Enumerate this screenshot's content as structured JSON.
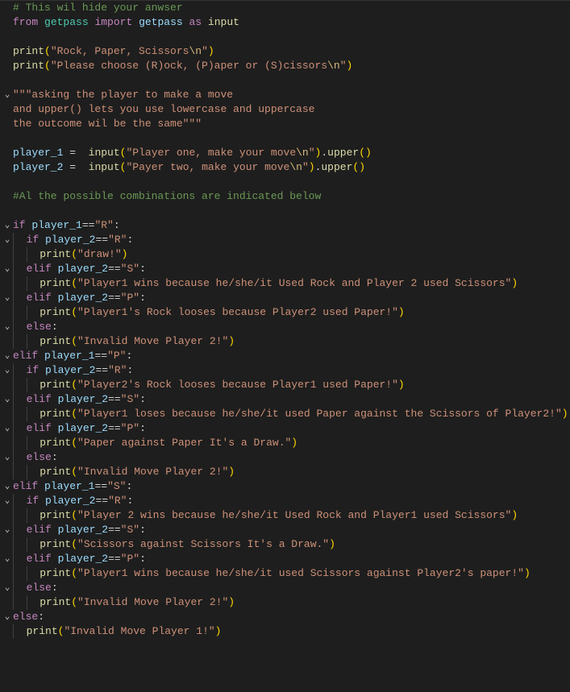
{
  "chevron": "⌄",
  "lines": {
    "l1": {
      "fold": false,
      "tokens": [
        [
          "c-comment",
          "# This wil hide your anwser"
        ]
      ]
    },
    "l2": {
      "fold": false,
      "tokens": [
        [
          "c-key",
          "from"
        ],
        [
          "",
          " "
        ],
        [
          "c-mod",
          "getpass"
        ],
        [
          "",
          " "
        ],
        [
          "c-key",
          "import"
        ],
        [
          "",
          " "
        ],
        [
          "c-var",
          "getpass"
        ],
        [
          "",
          " "
        ],
        [
          "c-key",
          "as"
        ],
        [
          "",
          " "
        ],
        [
          "c-func",
          "input"
        ]
      ]
    },
    "l3": {
      "fold": false,
      "tokens": []
    },
    "l4": {
      "fold": false,
      "tokens": [
        [
          "c-func",
          "print"
        ],
        [
          "c-brace",
          "("
        ],
        [
          "c-str",
          "\"Rock, Paper, Scissors"
        ],
        [
          "c-esc",
          "\\n"
        ],
        [
          "c-str",
          "\""
        ],
        [
          "c-brace",
          ")"
        ]
      ]
    },
    "l5": {
      "fold": false,
      "tokens": [
        [
          "c-func",
          "print"
        ],
        [
          "c-brace",
          "("
        ],
        [
          "c-str",
          "\"Please choose (R)ock, (P)aper or (S)cissors"
        ],
        [
          "c-esc",
          "\\n"
        ],
        [
          "c-str",
          "\""
        ],
        [
          "c-brace",
          ")"
        ]
      ]
    },
    "l6": {
      "fold": false,
      "tokens": []
    },
    "l7": {
      "fold": true,
      "tokens": [
        [
          "c-docstr",
          "\"\"\"asking the player to make a move"
        ]
      ]
    },
    "l8": {
      "fold": false,
      "tokens": [
        [
          "c-docstr",
          "and upper() lets you use lowercase and uppercase"
        ]
      ]
    },
    "l9": {
      "fold": false,
      "tokens": [
        [
          "c-docstr",
          "the outcome wil be the same\"\"\""
        ]
      ]
    },
    "l10": {
      "fold": false,
      "tokens": []
    },
    "l11": {
      "fold": false,
      "tokens": [
        [
          "c-var",
          "player_1"
        ],
        [
          "",
          " "
        ],
        [
          "c-op",
          "="
        ],
        [
          "",
          "  "
        ],
        [
          "c-func",
          "input"
        ],
        [
          "c-brace",
          "("
        ],
        [
          "c-str",
          "\"Player one, make your move"
        ],
        [
          "c-esc",
          "\\n"
        ],
        [
          "c-str",
          "\""
        ],
        [
          "c-brace",
          ")"
        ],
        [
          "c-punc",
          "."
        ],
        [
          "c-func",
          "upper"
        ],
        [
          "c-brace",
          "()"
        ]
      ]
    },
    "l12": {
      "fold": false,
      "tokens": [
        [
          "c-var",
          "player_2"
        ],
        [
          "",
          " "
        ],
        [
          "c-op",
          "="
        ],
        [
          "",
          "  "
        ],
        [
          "c-func",
          "input"
        ],
        [
          "c-brace",
          "("
        ],
        [
          "c-str",
          "\"Payer two, make your move"
        ],
        [
          "c-esc",
          "\\n"
        ],
        [
          "c-str",
          "\""
        ],
        [
          "c-brace",
          ")"
        ],
        [
          "c-punc",
          "."
        ],
        [
          "c-func",
          "upper"
        ],
        [
          "c-brace",
          "()"
        ]
      ]
    },
    "l13": {
      "fold": false,
      "tokens": []
    },
    "l14": {
      "fold": false,
      "tokens": [
        [
          "c-comment",
          "#Al the possible combinations are indicated below"
        ]
      ]
    },
    "l15": {
      "fold": false,
      "tokens": []
    },
    "l16": {
      "fold": true,
      "tokens": [
        [
          "c-key",
          "if"
        ],
        [
          "",
          " "
        ],
        [
          "c-var",
          "player_1"
        ],
        [
          "c-op",
          "=="
        ],
        [
          "c-str",
          "\"R\""
        ],
        [
          "c-punc",
          ":"
        ]
      ]
    },
    "l17": {
      "fold": true,
      "indent": 1,
      "tokens": [
        [
          "c-key",
          "if"
        ],
        [
          "",
          " "
        ],
        [
          "c-var",
          "player_2"
        ],
        [
          "c-op",
          "=="
        ],
        [
          "c-str",
          "\"R\""
        ],
        [
          "c-punc",
          ":"
        ]
      ]
    },
    "l18": {
      "fold": false,
      "indent": 2,
      "tokens": [
        [
          "c-func",
          "print"
        ],
        [
          "c-brace",
          "("
        ],
        [
          "c-str",
          "\"draw!\""
        ],
        [
          "c-brace",
          ")"
        ]
      ]
    },
    "l19": {
      "fold": true,
      "indent": 1,
      "tokens": [
        [
          "c-key",
          "elif"
        ],
        [
          "",
          " "
        ],
        [
          "c-var",
          "player_2"
        ],
        [
          "c-op",
          "=="
        ],
        [
          "c-str",
          "\"S\""
        ],
        [
          "c-punc",
          ":"
        ]
      ]
    },
    "l20": {
      "fold": false,
      "indent": 2,
      "tokens": [
        [
          "c-func",
          "print"
        ],
        [
          "c-brace",
          "("
        ],
        [
          "c-str",
          "\"Player1 wins because he/she/it Used Rock and Player 2 used Scissors\""
        ],
        [
          "c-brace",
          ")"
        ]
      ]
    },
    "l21": {
      "fold": true,
      "indent": 1,
      "tokens": [
        [
          "c-key",
          "elif"
        ],
        [
          "",
          " "
        ],
        [
          "c-var",
          "player_2"
        ],
        [
          "c-op",
          "=="
        ],
        [
          "c-str",
          "\"P\""
        ],
        [
          "c-punc",
          ":"
        ]
      ]
    },
    "l22": {
      "fold": false,
      "indent": 2,
      "tokens": [
        [
          "c-func",
          "print"
        ],
        [
          "c-brace",
          "("
        ],
        [
          "c-str",
          "\"Player1's Rock looses because Player2 used Paper!\""
        ],
        [
          "c-brace",
          ")"
        ]
      ]
    },
    "l23": {
      "fold": true,
      "indent": 1,
      "tokens": [
        [
          "c-key",
          "else"
        ],
        [
          "c-punc",
          ":"
        ]
      ]
    },
    "l24": {
      "fold": false,
      "indent": 2,
      "tokens": [
        [
          "c-func",
          "print"
        ],
        [
          "c-brace",
          "("
        ],
        [
          "c-str",
          "\"Invalid Move Player 2!\""
        ],
        [
          "c-brace",
          ")"
        ]
      ]
    },
    "l25": {
      "fold": true,
      "tokens": [
        [
          "c-key",
          "elif"
        ],
        [
          "",
          " "
        ],
        [
          "c-var",
          "player_1"
        ],
        [
          "c-op",
          "=="
        ],
        [
          "c-str",
          "\"P\""
        ],
        [
          "c-punc",
          ":"
        ]
      ]
    },
    "l26": {
      "fold": true,
      "indent": 1,
      "tokens": [
        [
          "c-key",
          "if"
        ],
        [
          "",
          " "
        ],
        [
          "c-var",
          "player_2"
        ],
        [
          "c-op",
          "=="
        ],
        [
          "c-str",
          "\"R\""
        ],
        [
          "c-punc",
          ":"
        ]
      ]
    },
    "l27": {
      "fold": false,
      "indent": 2,
      "tokens": [
        [
          "c-func",
          "print"
        ],
        [
          "c-brace",
          "("
        ],
        [
          "c-str",
          "\"Player2's Rock looses because Player1 used Paper!\""
        ],
        [
          "c-brace",
          ")"
        ]
      ]
    },
    "l28": {
      "fold": true,
      "indent": 1,
      "tokens": [
        [
          "c-key",
          "elif"
        ],
        [
          "",
          " "
        ],
        [
          "c-var",
          "player_2"
        ],
        [
          "c-op",
          "=="
        ],
        [
          "c-str",
          "\"S\""
        ],
        [
          "c-punc",
          ":"
        ]
      ]
    },
    "l29": {
      "fold": false,
      "indent": 2,
      "tokens": [
        [
          "c-func",
          "print"
        ],
        [
          "c-brace",
          "("
        ],
        [
          "c-str",
          "\"Player1 loses because he/she/it used Paper against the Scissors of Player2!\""
        ],
        [
          "c-brace",
          ")"
        ]
      ]
    },
    "l30": {
      "fold": true,
      "indent": 1,
      "tokens": [
        [
          "c-key",
          "elif"
        ],
        [
          "",
          " "
        ],
        [
          "c-var",
          "player_2"
        ],
        [
          "c-op",
          "=="
        ],
        [
          "c-str",
          "\"P\""
        ],
        [
          "c-punc",
          ":"
        ]
      ]
    },
    "l31": {
      "fold": false,
      "indent": 2,
      "tokens": [
        [
          "c-func",
          "print"
        ],
        [
          "c-brace",
          "("
        ],
        [
          "c-str",
          "\"Paper against Paper It's a Draw.\""
        ],
        [
          "c-brace",
          ")"
        ]
      ]
    },
    "l32": {
      "fold": true,
      "indent": 1,
      "tokens": [
        [
          "c-key",
          "else"
        ],
        [
          "c-punc",
          ":"
        ]
      ]
    },
    "l33": {
      "fold": false,
      "indent": 2,
      "tokens": [
        [
          "c-func",
          "print"
        ],
        [
          "c-brace",
          "("
        ],
        [
          "c-str",
          "\"Invalid Move Player 2!\""
        ],
        [
          "c-brace",
          ")"
        ]
      ]
    },
    "l34": {
      "fold": true,
      "tokens": [
        [
          "c-key",
          "elif"
        ],
        [
          "",
          " "
        ],
        [
          "c-var",
          "player_1"
        ],
        [
          "c-op",
          "=="
        ],
        [
          "c-str",
          "\"S\""
        ],
        [
          "c-punc",
          ":"
        ]
      ]
    },
    "l35": {
      "fold": true,
      "indent": 1,
      "tokens": [
        [
          "c-key",
          "if"
        ],
        [
          "",
          " "
        ],
        [
          "c-var",
          "player_2"
        ],
        [
          "c-op",
          "=="
        ],
        [
          "c-str",
          "\"R\""
        ],
        [
          "c-punc",
          ":"
        ]
      ]
    },
    "l36": {
      "fold": false,
      "indent": 2,
      "tokens": [
        [
          "c-func",
          "print"
        ],
        [
          "c-brace",
          "("
        ],
        [
          "c-str",
          "\"Player 2 wins because he/she/it Used Rock and Player1 used Scissors\""
        ],
        [
          "c-brace",
          ")"
        ]
      ]
    },
    "l37": {
      "fold": true,
      "indent": 1,
      "tokens": [
        [
          "c-key",
          "elif"
        ],
        [
          "",
          " "
        ],
        [
          "c-var",
          "player_2"
        ],
        [
          "c-op",
          "=="
        ],
        [
          "c-str",
          "\"S\""
        ],
        [
          "c-punc",
          ":"
        ]
      ]
    },
    "l38": {
      "fold": false,
      "indent": 2,
      "tokens": [
        [
          "c-func",
          "print"
        ],
        [
          "c-brace",
          "("
        ],
        [
          "c-str",
          "\"Scissors against Scissors It's a Draw.\""
        ],
        [
          "c-brace",
          ")"
        ]
      ]
    },
    "l39": {
      "fold": true,
      "indent": 1,
      "tokens": [
        [
          "c-key",
          "elif"
        ],
        [
          "",
          " "
        ],
        [
          "c-var",
          "player_2"
        ],
        [
          "c-op",
          "=="
        ],
        [
          "c-str",
          "\"P\""
        ],
        [
          "c-punc",
          ":"
        ]
      ]
    },
    "l40": {
      "fold": false,
      "indent": 2,
      "tokens": [
        [
          "c-func",
          "print"
        ],
        [
          "c-brace",
          "("
        ],
        [
          "c-str",
          "\"Player1 wins because he/she/it used Scissors against Player2's paper!\""
        ],
        [
          "c-brace",
          ")"
        ]
      ]
    },
    "l41": {
      "fold": true,
      "indent": 1,
      "tokens": [
        [
          "c-key",
          "else"
        ],
        [
          "c-punc",
          ":"
        ]
      ]
    },
    "l42": {
      "fold": false,
      "indent": 2,
      "tokens": [
        [
          "c-func",
          "print"
        ],
        [
          "c-brace",
          "("
        ],
        [
          "c-str",
          "\"Invalid Move Player 2!\""
        ],
        [
          "c-brace",
          ")"
        ]
      ]
    },
    "l43": {
      "fold": true,
      "tokens": [
        [
          "c-key",
          "else"
        ],
        [
          "c-punc",
          ":"
        ]
      ]
    },
    "l44": {
      "fold": false,
      "indent": 1,
      "tokens": [
        [
          "c-func",
          "print"
        ],
        [
          "c-brace",
          "("
        ],
        [
          "c-str",
          "\"Invalid Move Player 1!\""
        ],
        [
          "c-brace",
          ")"
        ]
      ]
    }
  },
  "line_order": [
    "l1",
    "l2",
    "l3",
    "l4",
    "l5",
    "l6",
    "l7",
    "l8",
    "l9",
    "l10",
    "l11",
    "l12",
    "l13",
    "l14",
    "l15",
    "l16",
    "l17",
    "l18",
    "l19",
    "l20",
    "l21",
    "l22",
    "l23",
    "l24",
    "l25",
    "l26",
    "l27",
    "l28",
    "l29",
    "l30",
    "l31",
    "l32",
    "l33",
    "l34",
    "l35",
    "l36",
    "l37",
    "l38",
    "l39",
    "l40",
    "l41",
    "l42",
    "l43",
    "l44"
  ]
}
